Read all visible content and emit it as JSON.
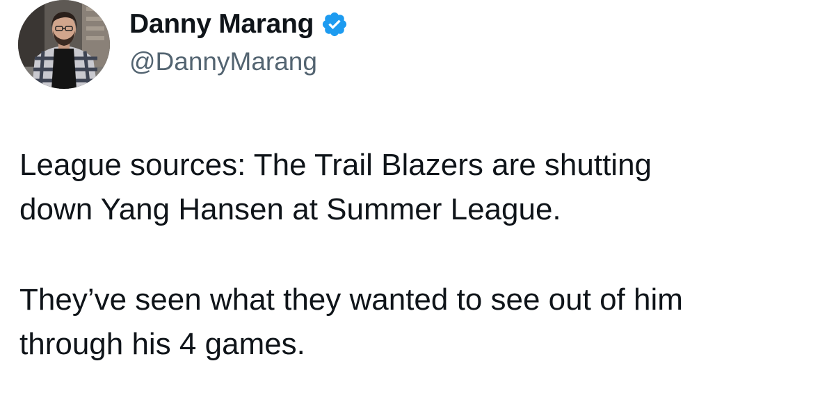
{
  "author": {
    "display_name": "Danny Marang",
    "handle": "@DannyMarang",
    "verified": true,
    "verified_badge_color": "#1d9bf0",
    "avatar_icon": "profile-photo"
  },
  "tweet": {
    "paragraphs": [
      "League sources: The Trail Blazers are shutting\ndown Yang Hansen at Summer League.",
      "They’ve seen what they wanted to see out of him\nthrough his 4 games."
    ]
  },
  "colors": {
    "text": "#0f1419",
    "secondary_text": "#536471",
    "background": "#ffffff"
  }
}
